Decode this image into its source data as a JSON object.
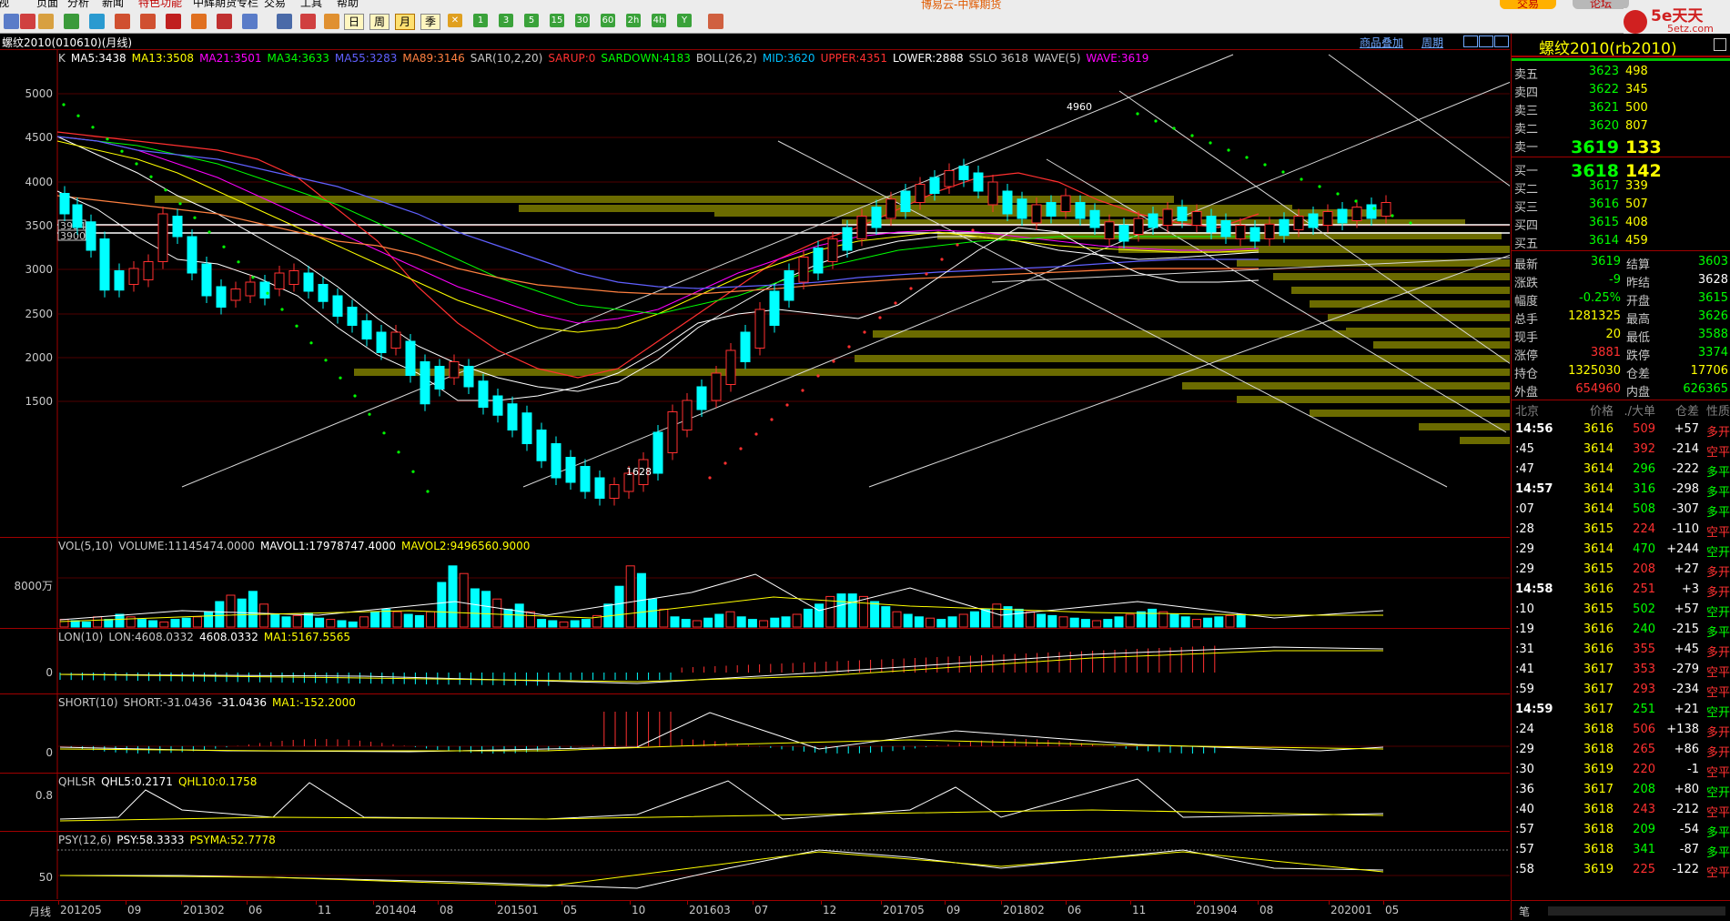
{
  "menu": {
    "items": [
      "视",
      "页面",
      "分析",
      "新闻",
      "特色功能",
      "中辉期货专栏",
      "交易",
      "工具",
      "帮助"
    ],
    "platform": "博易云-中辉期货",
    "trade": "交易",
    "forum": "论坛"
  },
  "logo": {
    "brand": "5e天天",
    "site": "5etz.com"
  },
  "toolbar": {
    "periods": [
      "日",
      "周",
      "月",
      "季"
    ],
    "selected": "月",
    "nums": [
      "1",
      "3",
      "5",
      "15",
      "30",
      "60",
      "2h",
      "4h",
      "Y"
    ]
  },
  "chart_title": "螺纹2010(010610)(月线)",
  "top_right_links": {
    "overlay": "商品叠加",
    "period": "周期"
  },
  "main": {
    "ind": [
      {
        "t": "K",
        "c": "#c8c8c8"
      },
      {
        "t": "MA5:3438",
        "c": "#ffffff"
      },
      {
        "t": "MA13:3508",
        "c": "#ffff00"
      },
      {
        "t": "MA21:3501",
        "c": "#ff00ff"
      },
      {
        "t": "MA34:3633",
        "c": "#00ff00"
      },
      {
        "t": "MA55:3283",
        "c": "#6060ff"
      },
      {
        "t": "MA89:3146",
        "c": "#ff8040"
      },
      {
        "t": "SAR(10,2,20)",
        "c": "#c8c8c8"
      },
      {
        "t": "SARUP:0",
        "c": "#ff3030"
      },
      {
        "t": "SARDOWN:4183",
        "c": "#00ff00"
      },
      {
        "t": "BOLL(26,2)",
        "c": "#c8c8c8"
      },
      {
        "t": "MID:3620",
        "c": "#00c0ff"
      },
      {
        "t": "UPPER:4351",
        "c": "#ff3030"
      },
      {
        "t": "LOWER:2888",
        "c": "#ffffff"
      },
      {
        "t": "SSLO 3618",
        "c": "#c8c8c8"
      },
      {
        "t": "WAVE(5)",
        "c": "#c8c8c8"
      },
      {
        "t": "WAVE:3619",
        "c": "#ff00ff"
      }
    ],
    "yticks": [
      "5000",
      "4500",
      "4000",
      "3500",
      "3000",
      "2500",
      "2000",
      "1500"
    ],
    "marks": {
      "high": "4960",
      "low": "1628",
      "p1": "3994",
      "p2": "3900"
    }
  },
  "vol": {
    "ind": [
      {
        "t": "VOL(5,10)",
        "c": "#c8c8c8"
      },
      {
        "t": "VOLUME:11145474.0000",
        "c": "#c8c8c8"
      },
      {
        "t": "MAVOL1:17978747.4000",
        "c": "#ffffff"
      },
      {
        "t": "MAVOL2:9496560.9000",
        "c": "#ffff00"
      }
    ],
    "ytick": "8000万"
  },
  "lon": {
    "ind": [
      {
        "t": "LON(10)",
        "c": "#c8c8c8"
      },
      {
        "t": "LON:4608.0332",
        "c": "#c8c8c8"
      },
      {
        "t": "4608.0332",
        "c": "#ffffff"
      },
      {
        "t": "MA1:5167.5565",
        "c": "#ffff00"
      }
    ],
    "ytick": "0"
  },
  "short": {
    "ind": [
      {
        "t": "SHORT(10)",
        "c": "#c8c8c8"
      },
      {
        "t": "SHORT:-31.0436",
        "c": "#c8c8c8"
      },
      {
        "t": "-31.0436",
        "c": "#ffffff"
      },
      {
        "t": "MA1:-152.2000",
        "c": "#ffff00"
      }
    ],
    "ytick": "0"
  },
  "qhl": {
    "ind": [
      {
        "t": "QHLSR",
        "c": "#c8c8c8"
      },
      {
        "t": "QHL5:0.2171",
        "c": "#ffffff"
      },
      {
        "t": "QHL10:0.1758",
        "c": "#ffff00"
      }
    ],
    "ytick": "0.8"
  },
  "psy": {
    "ind": [
      {
        "t": "PSY(12,6)",
        "c": "#c8c8c8"
      },
      {
        "t": "PSY:58.3333",
        "c": "#ffffff"
      },
      {
        "t": "PSYMA:52.7778",
        "c": "#ffff00"
      }
    ],
    "ytick": "50"
  },
  "xaxis": {
    "label": "月线",
    "ticks": [
      "201205",
      "09",
      "201302",
      "06",
      "11",
      "201404",
      "08",
      "201501",
      "05",
      "10",
      "201603",
      "07",
      "12",
      "201705",
      "09",
      "201802",
      "06",
      "11",
      "201904",
      "08",
      "202001",
      "05"
    ]
  },
  "side": {
    "title": "螺纹2010(rb2010)",
    "asks": [
      {
        "l": "卖五",
        "p": "3623",
        "v": "498"
      },
      {
        "l": "卖四",
        "p": "3622",
        "v": "345"
      },
      {
        "l": "卖三",
        "p": "3621",
        "v": "500"
      },
      {
        "l": "卖二",
        "p": "3620",
        "v": "807"
      },
      {
        "l": "卖一",
        "p": "3619",
        "v": "133"
      }
    ],
    "bids": [
      {
        "l": "买一",
        "p": "3618",
        "v": "142"
      },
      {
        "l": "买二",
        "p": "3617",
        "v": "339"
      },
      {
        "l": "买三",
        "p": "3616",
        "v": "507"
      },
      {
        "l": "买四",
        "p": "3615",
        "v": "408"
      },
      {
        "l": "买五",
        "p": "3614",
        "v": "459"
      }
    ],
    "stats": [
      {
        "l1": "最新",
        "v1": "3619",
        "c1": "#00ff00",
        "l2": "结算",
        "v2": "3603",
        "c2": "#00ff00"
      },
      {
        "l1": "涨跌",
        "v1": "-9",
        "c1": "#00ff00",
        "l2": "昨结",
        "v2": "3628",
        "c2": "#ffffff"
      },
      {
        "l1": "幅度",
        "v1": "-0.25%",
        "c1": "#00ff00",
        "l2": "开盘",
        "v2": "3615",
        "c2": "#00ff00"
      },
      {
        "l1": "总手",
        "v1": "1281325",
        "c1": "#ffff00",
        "l2": "最高",
        "v2": "3626",
        "c2": "#00ff00"
      },
      {
        "l1": "现手",
        "v1": "20",
        "c1": "#ffff00",
        "l2": "最低",
        "v2": "3588",
        "c2": "#00ff00"
      },
      {
        "l1": "涨停",
        "v1": "3881",
        "c1": "#ff3030",
        "l2": "跌停",
        "v2": "3374",
        "c2": "#00ff00"
      },
      {
        "l1": "持仓",
        "v1": "1325030",
        "c1": "#ffff00",
        "l2": "仓差",
        "v2": "17706",
        "c2": "#ffff00"
      },
      {
        "l1": "外盘",
        "v1": "654960",
        "c1": "#ff3030",
        "l2": "内盘",
        "v2": "626365",
        "c2": "#00ff00"
      }
    ],
    "tick_header": {
      "loc": "北京",
      "price": "价格",
      "vol": "./大单",
      "oi": "仓差",
      "type": "性质"
    },
    "ticks": [
      {
        "t": "14:56",
        "v": "509",
        "p": "3616",
        "o": "+57",
        "k": "多开",
        "c": "r"
      },
      {
        "t": ":45",
        "v": "392",
        "p": "3614",
        "o": "-214",
        "k": "空平",
        "c": "r"
      },
      {
        "t": ":47",
        "v": "296",
        "p": "3614",
        "o": "-222",
        "k": "多平",
        "c": "g"
      },
      {
        "t": "14:57",
        "v": "316",
        "p": "3614",
        "o": "-298",
        "k": "多平",
        "c": "g"
      },
      {
        "t": ":07",
        "v": "508",
        "p": "3614",
        "o": "-307",
        "k": "多平",
        "c": "g"
      },
      {
        "t": ":28",
        "v": "224",
        "p": "3615",
        "o": "-110",
        "k": "空平",
        "c": "r"
      },
      {
        "t": ":29",
        "v": "470",
        "p": "3614",
        "o": "+244",
        "k": "空开",
        "c": "g"
      },
      {
        "t": ":29",
        "v": "208",
        "p": "3615",
        "o": "+27",
        "k": "多开",
        "c": "r"
      },
      {
        "t": "14:58",
        "v": "251",
        "p": "3616",
        "o": "+3",
        "k": "多开",
        "c": "r"
      },
      {
        "t": ":10",
        "v": "502",
        "p": "3615",
        "o": "+57",
        "k": "空开",
        "c": "g"
      },
      {
        "t": ":19",
        "v": "240",
        "p": "3616",
        "o": "-215",
        "k": "多平",
        "c": "g"
      },
      {
        "t": ":31",
        "v": "355",
        "p": "3616",
        "o": "+45",
        "k": "多开",
        "c": "r"
      },
      {
        "t": ":41",
        "v": "353",
        "p": "3617",
        "o": "-279",
        "k": "空平",
        "c": "r"
      },
      {
        "t": ":59",
        "v": "293",
        "p": "3617",
        "o": "-234",
        "k": "空平",
        "c": "r"
      },
      {
        "t": "14:59",
        "v": "251",
        "p": "3617",
        "o": "+21",
        "k": "空开",
        "c": "g"
      },
      {
        "t": ":24",
        "v": "506",
        "p": "3618",
        "o": "+138",
        "k": "多开",
        "c": "r"
      },
      {
        "t": ":29",
        "v": "265",
        "p": "3618",
        "o": "+86",
        "k": "多开",
        "c": "r"
      },
      {
        "t": ":30",
        "v": "220",
        "p": "3619",
        "o": "-1",
        "k": "空平",
        "c": "r"
      },
      {
        "t": ":36",
        "v": "208",
        "p": "3617",
        "o": "+80",
        "k": "空开",
        "c": "g"
      },
      {
        "t": ":40",
        "v": "243",
        "p": "3618",
        "o": "-212",
        "k": "空平",
        "c": "r"
      },
      {
        "t": ":57",
        "v": "209",
        "p": "3618",
        "o": "-54",
        "k": "多平",
        "c": "g"
      },
      {
        "t": ":57",
        "v": "341",
        "p": "3618",
        "o": "-87",
        "k": "多平",
        "c": "g"
      },
      {
        "t": ":58",
        "v": "225",
        "p": "3619",
        "o": "-122",
        "k": "空平",
        "c": "r"
      }
    ],
    "footer": "笔"
  }
}
